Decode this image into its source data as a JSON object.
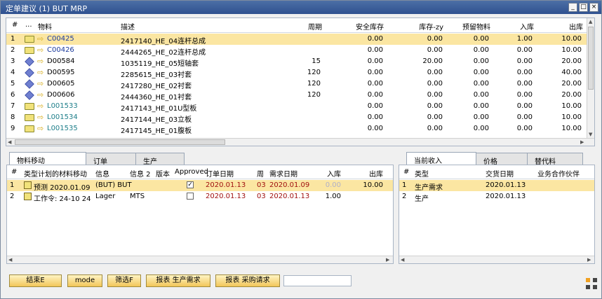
{
  "window": {
    "title": "定单建议 (1) BUT MRP",
    "buttons": {
      "minimize": "_",
      "maximize": "□",
      "close": "×"
    }
  },
  "main_grid": {
    "headers": {
      "num": "#",
      "dots": "...",
      "item": "物料",
      "desc": "描述",
      "period": "周期",
      "safety": "安全库存",
      "stock": "库存-zy",
      "reserved": "预留物料",
      "in": "入库",
      "out": "出库"
    },
    "rows": [
      {
        "num": "1",
        "icon": "folder",
        "code": "C00425",
        "desc": "2417140_HE_04连杆总成",
        "period": "",
        "safety": "0.00",
        "stock": "0.00",
        "reserved": "0.00",
        "in": "1.00",
        "out": "10.00",
        "style": "link"
      },
      {
        "num": "2",
        "icon": "folder",
        "code": "C00426",
        "desc": "2444265_HE_02连杆总成",
        "period": "",
        "safety": "0.00",
        "stock": "0.00",
        "reserved": "0.00",
        "in": "0.00",
        "out": "10.00",
        "style": "link"
      },
      {
        "num": "3",
        "icon": "cube",
        "code": "D00584",
        "desc": "1035119_HE_05短轴套",
        "period": "15",
        "safety": "0.00",
        "stock": "20.00",
        "reserved": "0.00",
        "in": "0.00",
        "out": "20.00",
        "style": "plain"
      },
      {
        "num": "4",
        "icon": "cube",
        "code": "D00595",
        "desc": "2285615_HE_03衬套",
        "period": "120",
        "safety": "0.00",
        "stock": "0.00",
        "reserved": "0.00",
        "in": "0.00",
        "out": "40.00",
        "style": "plain"
      },
      {
        "num": "5",
        "icon": "cube",
        "code": "D00605",
        "desc": "2417280_HE_02衬套",
        "period": "120",
        "safety": "0.00",
        "stock": "0.00",
        "reserved": "0.00",
        "in": "0.00",
        "out": "20.00",
        "style": "plain"
      },
      {
        "num": "6",
        "icon": "cube",
        "code": "D00606",
        "desc": "2444360_HE_01衬套",
        "period": "120",
        "safety": "0.00",
        "stock": "0.00",
        "reserved": "0.00",
        "in": "0.00",
        "out": "20.00",
        "style": "plain"
      },
      {
        "num": "7",
        "icon": "folder",
        "code": "L001533",
        "desc": "2417143_HE_01U型板",
        "period": "",
        "safety": "0.00",
        "stock": "0.00",
        "reserved": "0.00",
        "in": "0.00",
        "out": "10.00",
        "style": "linkg"
      },
      {
        "num": "8",
        "icon": "folder",
        "code": "L001534",
        "desc": "2417144_HE_03立板",
        "period": "",
        "safety": "0.00",
        "stock": "0.00",
        "reserved": "0.00",
        "in": "0.00",
        "out": "10.00",
        "style": "linkg"
      },
      {
        "num": "9",
        "icon": "folder",
        "code": "L001535",
        "desc": "2417145_HE_01腹板",
        "period": "",
        "safety": "0.00",
        "stock": "0.00",
        "reserved": "0.00",
        "in": "0.00",
        "out": "10.00",
        "style": "linkg"
      }
    ]
  },
  "left_tabs": [
    "物料移动",
    "订单",
    "生产"
  ],
  "movement_grid": {
    "headers": {
      "num": "#",
      "type": "类型计划的材料移动",
      "info": "信息",
      "info2": "信息 2",
      "version": "版本",
      "approved": "Approved",
      "order_date": "订单日期",
      "week": "周",
      "req_date": "需求日期",
      "in": "入库",
      "out": "出库"
    },
    "rows": [
      {
        "num": "1",
        "type": "预测 2020.01.09",
        "info": "(BUT) BUT",
        "info2": "",
        "version": "",
        "approved": "✓",
        "order_date": "2020.01.13",
        "week": "03",
        "req_date": "2020.01.09",
        "in": "0.00",
        "out": "10.00"
      },
      {
        "num": "2",
        "type": "工作令: 24-10 24",
        "info": "Lager",
        "info2": "MTS",
        "version": "",
        "approved": "",
        "order_date": "2020.01.13",
        "week": "03",
        "req_date": "2020.01.13",
        "in": "1.00",
        "out": ""
      }
    ]
  },
  "right_tabs": [
    "当前收入",
    "价格",
    "替代料"
  ],
  "receipt_grid": {
    "headers": {
      "num": "#",
      "type": "类型",
      "date": "交货日期",
      "partner": "业务合作伙伴"
    },
    "rows": [
      {
        "num": "1",
        "type": "生产需求",
        "date": "2020.01.13",
        "partner": ""
      },
      {
        "num": "2",
        "type": "生产",
        "date": "2020.01.13",
        "partner": ""
      }
    ]
  },
  "buttons": {
    "end": "结束E",
    "mode": "mode",
    "filter": "筛选F",
    "report_prod": "报表 生产需求",
    "report_purch": "报表 采购请求"
  },
  "colors": {
    "selected_row": "#fbe6a2",
    "title_bar": "#2f5190",
    "button_gold": "#f2c659"
  }
}
